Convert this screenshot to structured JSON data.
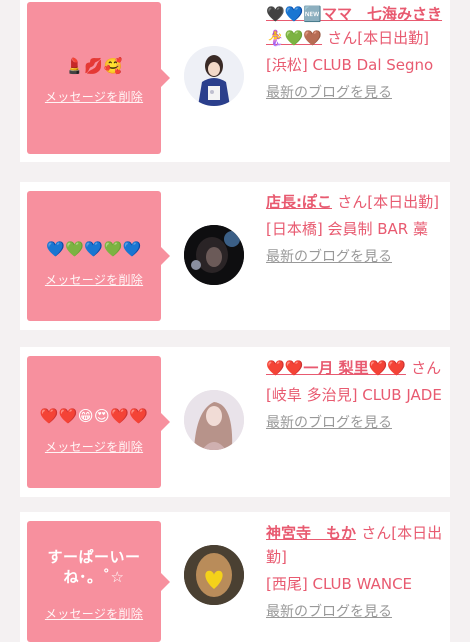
{
  "cards": [
    {
      "message": "💄💋🥰",
      "delete_label": "メッセージを削除",
      "avatar": "woman-in-kimono-photo",
      "name_parts": [
        "🖤💙🆕ママ　七海みさき🧜‍♀️💚🤎"
      ],
      "name": "🖤💙🆕ママ　七海みさき🧜‍♀️💚🤎",
      "suffix": "さん[本日出勤]",
      "shop": "[浜松] CLUB Dal Segno",
      "blog_label": "最新のブログを見る"
    },
    {
      "message": "💙💚💙💚💙",
      "delete_label": "メッセージを削除",
      "avatar": "dark-portrait-photo",
      "name": "店長:ぽこ",
      "suffix": "さん[本日出勤]",
      "shop": "[日本橋] 会員制 BAR 藁",
      "blog_label": "最新のブログを見る"
    },
    {
      "message": "❤️❤️😁😍❤️❤️",
      "delete_label": "メッセージを削除",
      "avatar": "long-hair-woman-photo",
      "name": "❤️❤️一月 梨里❤️❤️",
      "suffix": "さん",
      "shop": "[岐阜 多治見] CLUB JADE",
      "blog_label": "最新のブログを見る"
    },
    {
      "message": "すーぱーいーね･。˚☆",
      "delete_label": "メッセージを削除",
      "avatar": "heart-covered-face-photo",
      "name": "神宮寺　もか",
      "suffix": "さん[本日出勤]",
      "shop": "[西尾] CLUB WANCE",
      "blog_label": "最新のブログを見る"
    }
  ],
  "colors": {
    "bubble": "#f7909e",
    "link": "#e85a70",
    "muted": "#999999"
  }
}
